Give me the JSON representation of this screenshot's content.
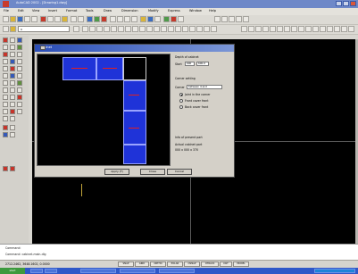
{
  "app": {
    "title": "AutoCAD 2002 - [Drawing1.dwg]"
  },
  "menu": {
    "items": [
      "File",
      "Edit",
      "View",
      "Insert",
      "Format",
      "Tools",
      "Draw",
      "Dimension",
      "Modify",
      "Express",
      "Window",
      "Help"
    ]
  },
  "toolbar_layer": {
    "layer_value": "0",
    "linetype_value": "ByLayer",
    "color_value": "ByLayer"
  },
  "dialog": {
    "title": "Cabinet",
    "depth_group": "Depth of cabinet",
    "depth_label": "Start",
    "depth_value": "600",
    "depth_value2": "600.0",
    "corner_group": "Corner setting",
    "corner_label": "Corner",
    "corner_value": "between 4 and",
    "radio1": "Joint in the corner",
    "radio2": "Front cover front",
    "radio3": "Back cover front",
    "info1": "Info of present part",
    "info2": "Actual cabinet part",
    "info3": "000 x 000 x 370",
    "btn_apply": "Apply (F)",
    "btn_close": "Close",
    "btn_cancel": "Cancel"
  },
  "command": {
    "line1": "Command:",
    "line2": "Command: cabinet-main-dlg"
  },
  "status": {
    "coords": "2712.2462, 3648.1602, 0.0000",
    "buttons": [
      "SNAP",
      "GRID",
      "ORTHO",
      "POLAR",
      "OSNAP",
      "OTRACK",
      "LWT",
      "MODEL"
    ]
  },
  "taskbar": {
    "start": "start"
  },
  "colors": {
    "cabinet_blue": "#1f33d8",
    "cabinet_red": "#e02020",
    "canvas": "#000000"
  }
}
